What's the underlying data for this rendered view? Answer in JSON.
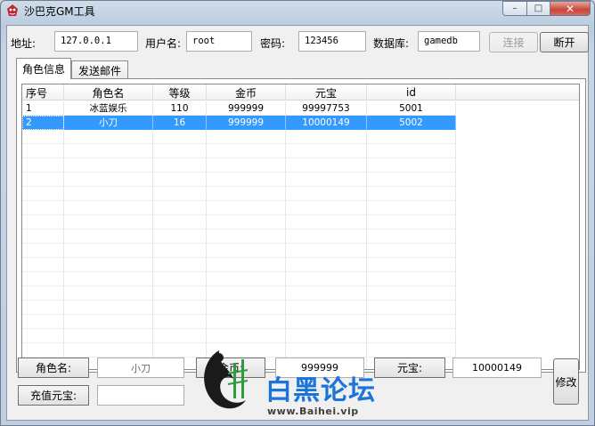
{
  "window": {
    "title": "沙巴克GM工具"
  },
  "titlebar_buttons": {
    "minimize": "–",
    "maximize": "□",
    "close": "✕"
  },
  "connection": {
    "address_label": "地址:",
    "address_value": "127.0.0.1",
    "user_label": "用户名:",
    "user_value": "root",
    "password_label": "密码:",
    "password_value": "123456",
    "database_label": "数据库:",
    "database_value": "gamedb",
    "connect_button": "连接",
    "disconnect_button": "断开"
  },
  "tabs": [
    {
      "label": "角色信息",
      "active": true
    },
    {
      "label": "发送邮件",
      "active": false
    }
  ],
  "table": {
    "columns": [
      "序号",
      "角色名",
      "等级",
      "金币",
      "元宝",
      "id"
    ],
    "rows": [
      [
        "1",
        "冰蓝娱乐",
        "110",
        "999999",
        "99997753",
        "5001"
      ],
      [
        "2",
        "小刀",
        "16",
        "999999",
        "10000149",
        "5002"
      ]
    ],
    "selected_row": 2
  },
  "editor": {
    "name_label": "角色名:",
    "name_value": "小刀",
    "gold_label": "金币:",
    "gold_value": "999999",
    "yuanbao_label": "元宝:",
    "yuanbao_value": "10000149",
    "recharge_label": "充值元宝:",
    "recharge_value": "",
    "modify_button": "修改"
  },
  "watermark": {
    "brand": "白黑论坛",
    "url": "www.Baihei.vip"
  },
  "colors": {
    "selection": "#3399ff",
    "brand_blue": "#1b74d8",
    "titlebar": "#c4d4e6"
  }
}
